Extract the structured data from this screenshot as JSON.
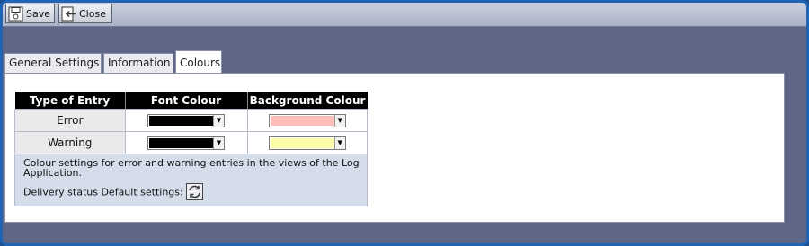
{
  "toolbar": {
    "save_label": "Save",
    "close_label": "Close"
  },
  "tabs": [
    {
      "label": "General Settings",
      "active": false
    },
    {
      "label": "Information",
      "active": false
    },
    {
      "label": "Colours",
      "active": true
    }
  ],
  "table": {
    "headers": [
      "Type of Entry",
      "Font Colour",
      "Background Colour"
    ],
    "rows": [
      {
        "entry": "Error",
        "font_colour": "#000000",
        "background_colour": "#ffbfb8"
      },
      {
        "entry": "Warning",
        "font_colour": "#000000",
        "background_colour": "#ffffaa"
      }
    ]
  },
  "description": "Colour settings for error and warning entries in the views of the Log Application.",
  "default_settings_label": "Delivery status Default settings:",
  "icons": {
    "save": "save-icon",
    "close": "close-icon",
    "reset": "reset-defaults-icon"
  }
}
